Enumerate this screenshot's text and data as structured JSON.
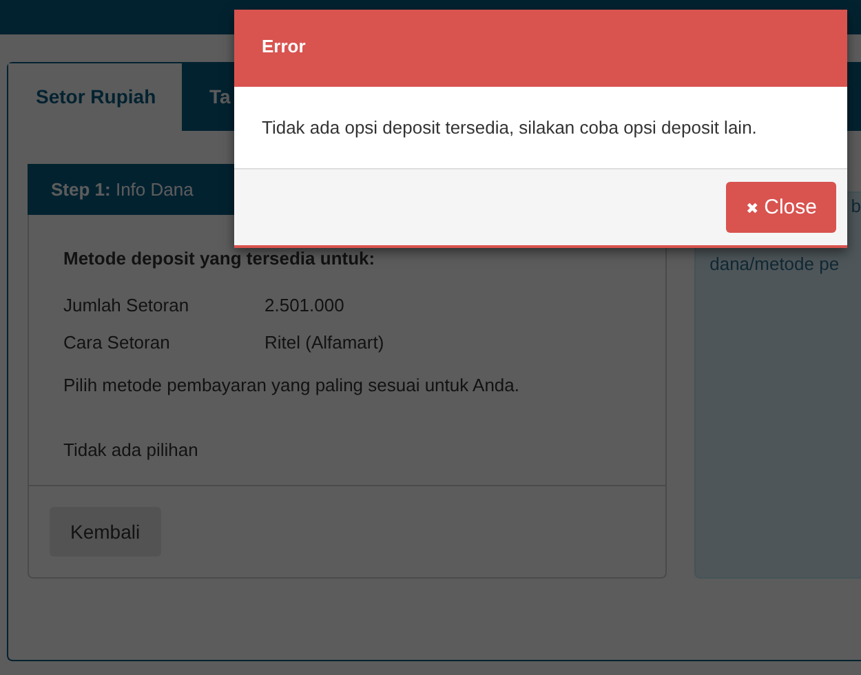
{
  "tabs": [
    {
      "label": "Setor Rupiah",
      "selected": true
    },
    {
      "label": "Ta",
      "selected": false
    }
  ],
  "step": {
    "number": "Step 1:",
    "label": "Info Dana"
  },
  "panel": {
    "heading": "Metode deposit yang tersedia untuk:",
    "fields": [
      {
        "label": "Jumlah Setoran",
        "value": "2.501.000"
      },
      {
        "label": "Cara Setoran",
        "value": "Ritel (Alfamart)"
      }
    ],
    "instruction": "Pilih metode pembayaran yang paling sesuai untuk Anda.",
    "empty_text": "Tidak ada pilihan",
    "back_button": "Kembali"
  },
  "info_box": {
    "lines": [
      "b",
      "dana/metode pe"
    ]
  },
  "modal": {
    "title": "Error",
    "message": "Tidak ada opsi deposit tersedia, silakan coba opsi deposit lain.",
    "close_icon": "✖",
    "close_button": "Close"
  }
}
